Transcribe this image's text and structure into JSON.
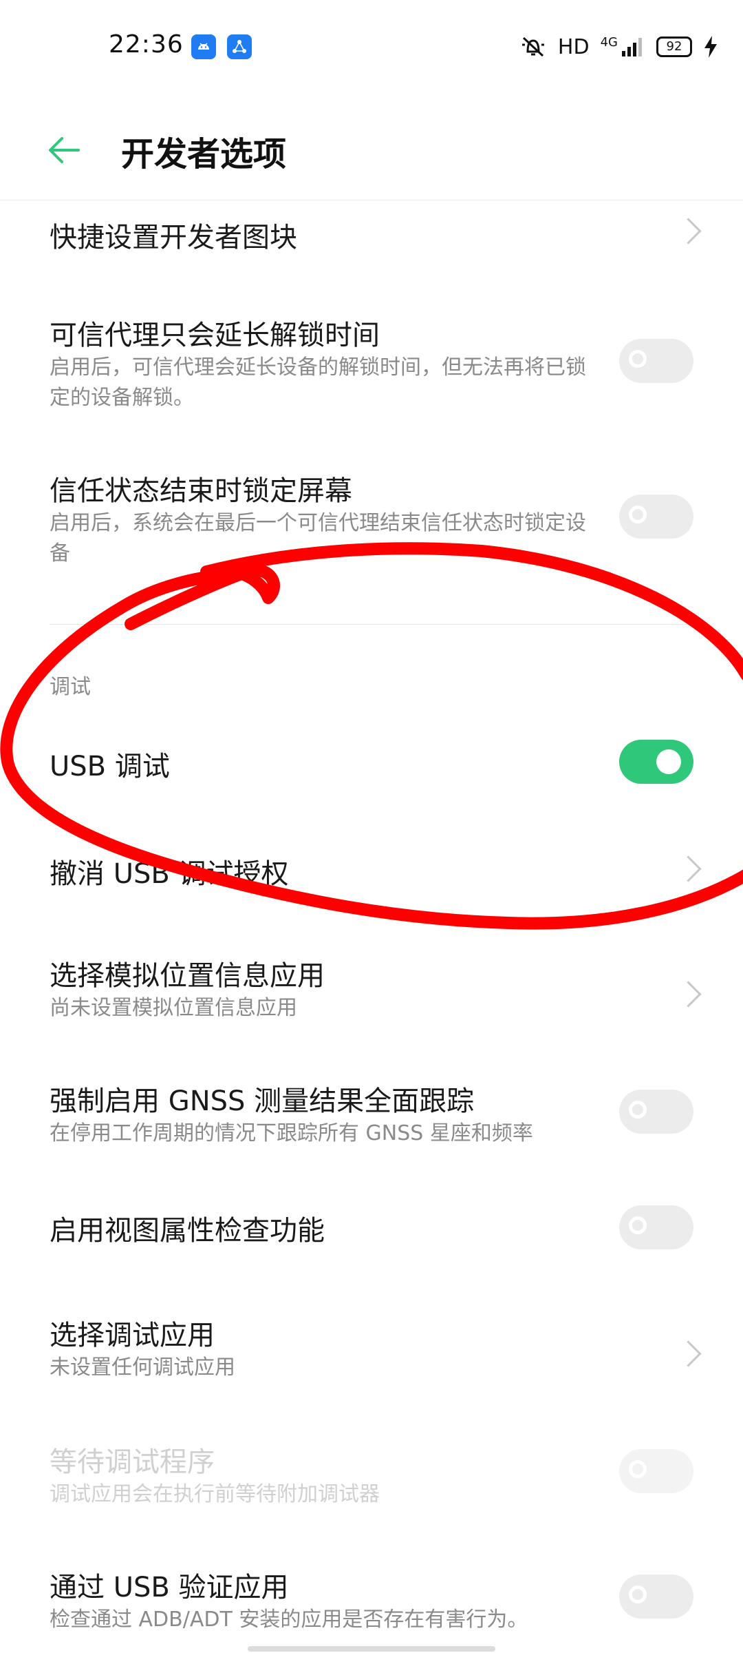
{
  "status_bar": {
    "time": "22:36",
    "network": "HD",
    "signal": "4G",
    "battery": "92",
    "icons": [
      "android-app-icon",
      "share-app-icon",
      "mute-bell-icon",
      "signal-icon",
      "charging-icon"
    ]
  },
  "header": {
    "title": "开发者选项",
    "back_icon": "back-arrow-icon"
  },
  "items": {
    "quick_tiles": {
      "title": "快捷设置开发者图块"
    },
    "trust_agent_extend": {
      "title": "可信代理只会延长解锁时间",
      "subtitle": "启用后，可信代理会延长设备的解锁时间，但无法再将已锁定的设备解锁。",
      "state": "off"
    },
    "lock_on_trust_end": {
      "title": "信任状态结束时锁定屏幕",
      "subtitle": "启用后，系统会在最后一个可信代理结束信任状态时锁定设备",
      "state": "off"
    },
    "debug_section": {
      "label": "调试"
    },
    "usb_debug": {
      "title": "USB 调试",
      "state": "on"
    },
    "revoke_usb": {
      "title": "撤消 USB 调试授权"
    },
    "mock_location": {
      "title": "选择模拟位置信息应用",
      "subtitle": "尚未设置模拟位置信息应用"
    },
    "gnss": {
      "title": "强制启用 GNSS 测量结果全面跟踪",
      "subtitle": "在停用工作周期的情况下跟踪所有 GNSS 星座和频率",
      "state": "off"
    },
    "view_attr": {
      "title": "启用视图属性检查功能",
      "state": "off"
    },
    "debug_app": {
      "title": "选择调试应用",
      "subtitle": "未设置任何调试应用"
    },
    "wait_debugger": {
      "title": "等待调试程序",
      "subtitle": "调试应用会在执行前等待附加调试器",
      "state": "disabled"
    },
    "verify_usb": {
      "title": "通过 USB 验证应用",
      "subtitle": "检查通过 ADB/ADT 安装的应用是否存在有害行为。",
      "state": "off"
    }
  },
  "colors": {
    "accent": "#2fc87a",
    "annotation": "#ff0000",
    "back_arrow": "#2fc87a"
  }
}
